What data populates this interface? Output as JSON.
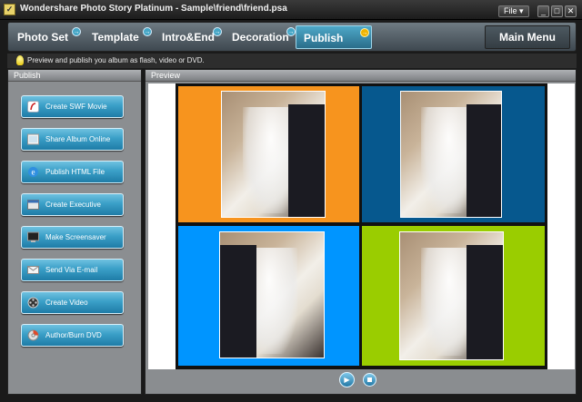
{
  "window": {
    "title": "Wondershare Photo Story Platinum - Sample\\friend\\friend.psa",
    "file_menu": "File ▾",
    "minimize": "_",
    "maximize": "□",
    "close": "✕"
  },
  "tabs": [
    {
      "label": "Photo Set",
      "arrow": "→"
    },
    {
      "label": "Template",
      "arrow": "→"
    },
    {
      "label": "Intro&End",
      "arrow": "→"
    },
    {
      "label": "Decoration",
      "arrow": "→"
    },
    {
      "label": "Publish",
      "arrow": "→",
      "active": true
    }
  ],
  "main_menu": "Main Menu",
  "hint": "Preview and publish you album as flash, video or DVD.",
  "left_panel": {
    "title": "Publish",
    "buttons": [
      {
        "label": "Create SWF Movie",
        "icon": "swf-icon"
      },
      {
        "label": "Share Album Online",
        "icon": "share-online-icon"
      },
      {
        "label": "Publish HTML File",
        "icon": "ie-icon"
      },
      {
        "label": "Create Executive",
        "icon": "executive-icon"
      },
      {
        "label": "Make Screensaver",
        "icon": "screensaver-icon"
      },
      {
        "label": "Send Via E-mail",
        "icon": "email-icon"
      },
      {
        "label": "Create Video",
        "icon": "video-reel-icon"
      },
      {
        "label": "Author/Burn DVD",
        "icon": "dvd-icon"
      }
    ]
  },
  "preview": {
    "title": "Preview",
    "cells": [
      {
        "color": "#F7941E"
      },
      {
        "color": "#06588E"
      },
      {
        "color": "#0095FF"
      },
      {
        "color": "#9ACD00"
      }
    ]
  },
  "colors": {
    "accent": "#3A9FC7",
    "active_tab_arrow": "#F0B400"
  }
}
